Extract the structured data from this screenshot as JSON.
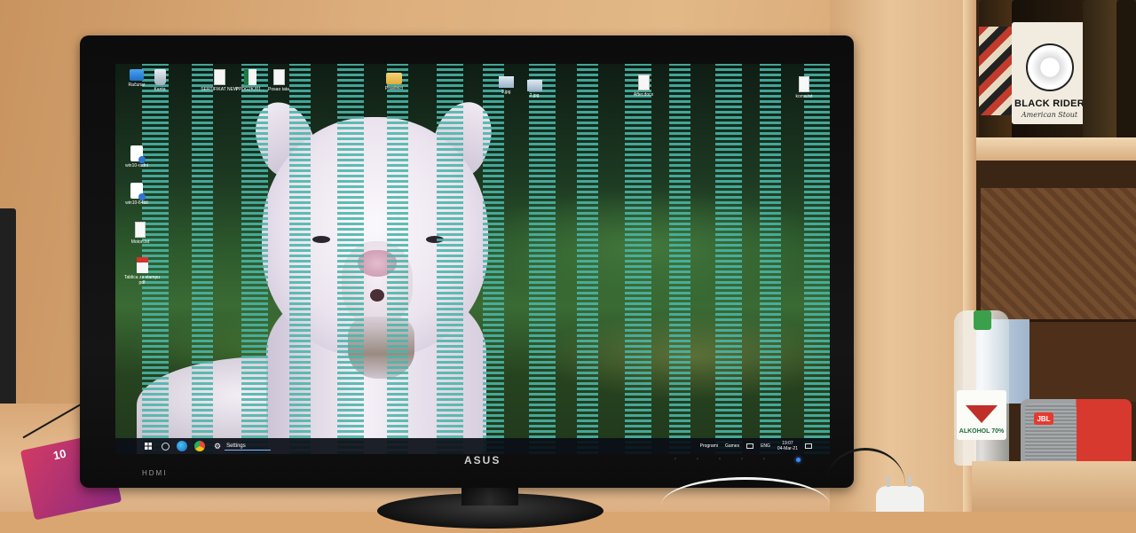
{
  "scene": {
    "monitor_brand": "ASUS",
    "monitor_port_label": "HDMI"
  },
  "desktop": {
    "icons": [
      {
        "name": "desktop-icon-racunar",
        "label": "Računar",
        "glyph": "pc"
      },
      {
        "name": "desktop-icon-kanta",
        "label": "Kanta",
        "glyph": "bin"
      },
      {
        "name": "desktop-icon-sertifikat",
        "label": "SERTIFIKAT NEW",
        "glyph": "doc"
      },
      {
        "name": "desktop-icon-ppdg",
        "label": "PPDG2KJ01...",
        "glyph": "xls"
      },
      {
        "name": "desktop-icon-posao-tata",
        "label": "Posao tata",
        "glyph": "doc"
      },
      {
        "name": "desktop-icon-pravilnici",
        "label": "Pravilnici",
        "glyph": "folder"
      },
      {
        "name": "desktop-icon-1jpg",
        "label": "1.jpg",
        "glyph": "jpg"
      },
      {
        "name": "desktop-icon-2jpg",
        "label": "2.jpg",
        "glyph": "jpg"
      },
      {
        "name": "desktop-icon-afterdocx",
        "label": "After.docx",
        "glyph": "doc"
      },
      {
        "name": "desktop-icon-komatxt",
        "label": "koma.txt",
        "glyph": "txt"
      },
      {
        "name": "desktop-icon-win10-radni",
        "label": "win10-radni",
        "glyph": "sh"
      },
      {
        "name": "desktop-icon-win10-64bit",
        "label": "win10-64bit",
        "glyph": "sh"
      },
      {
        "name": "desktop-icon-motori",
        "label": "Motori.txt",
        "glyph": "txt"
      },
      {
        "name": "desktop-icon-tablica",
        "label": "Tablica za stampu pdf",
        "glyph": "pdf"
      }
    ]
  },
  "taskbar": {
    "settings_label": "Settings",
    "tray_apps_label": "Programi",
    "tray_games_label": "Games",
    "tray_lang": "ENG",
    "clock_time": "19:07",
    "clock_date": "04-Mar-21"
  },
  "shelf": {
    "beer_name": "BLACK RIDER",
    "beer_subtitle": "American Stout",
    "bottle_label": "ALKOHOL 70%",
    "speaker_brand": "JBL",
    "promo_number": "10"
  }
}
